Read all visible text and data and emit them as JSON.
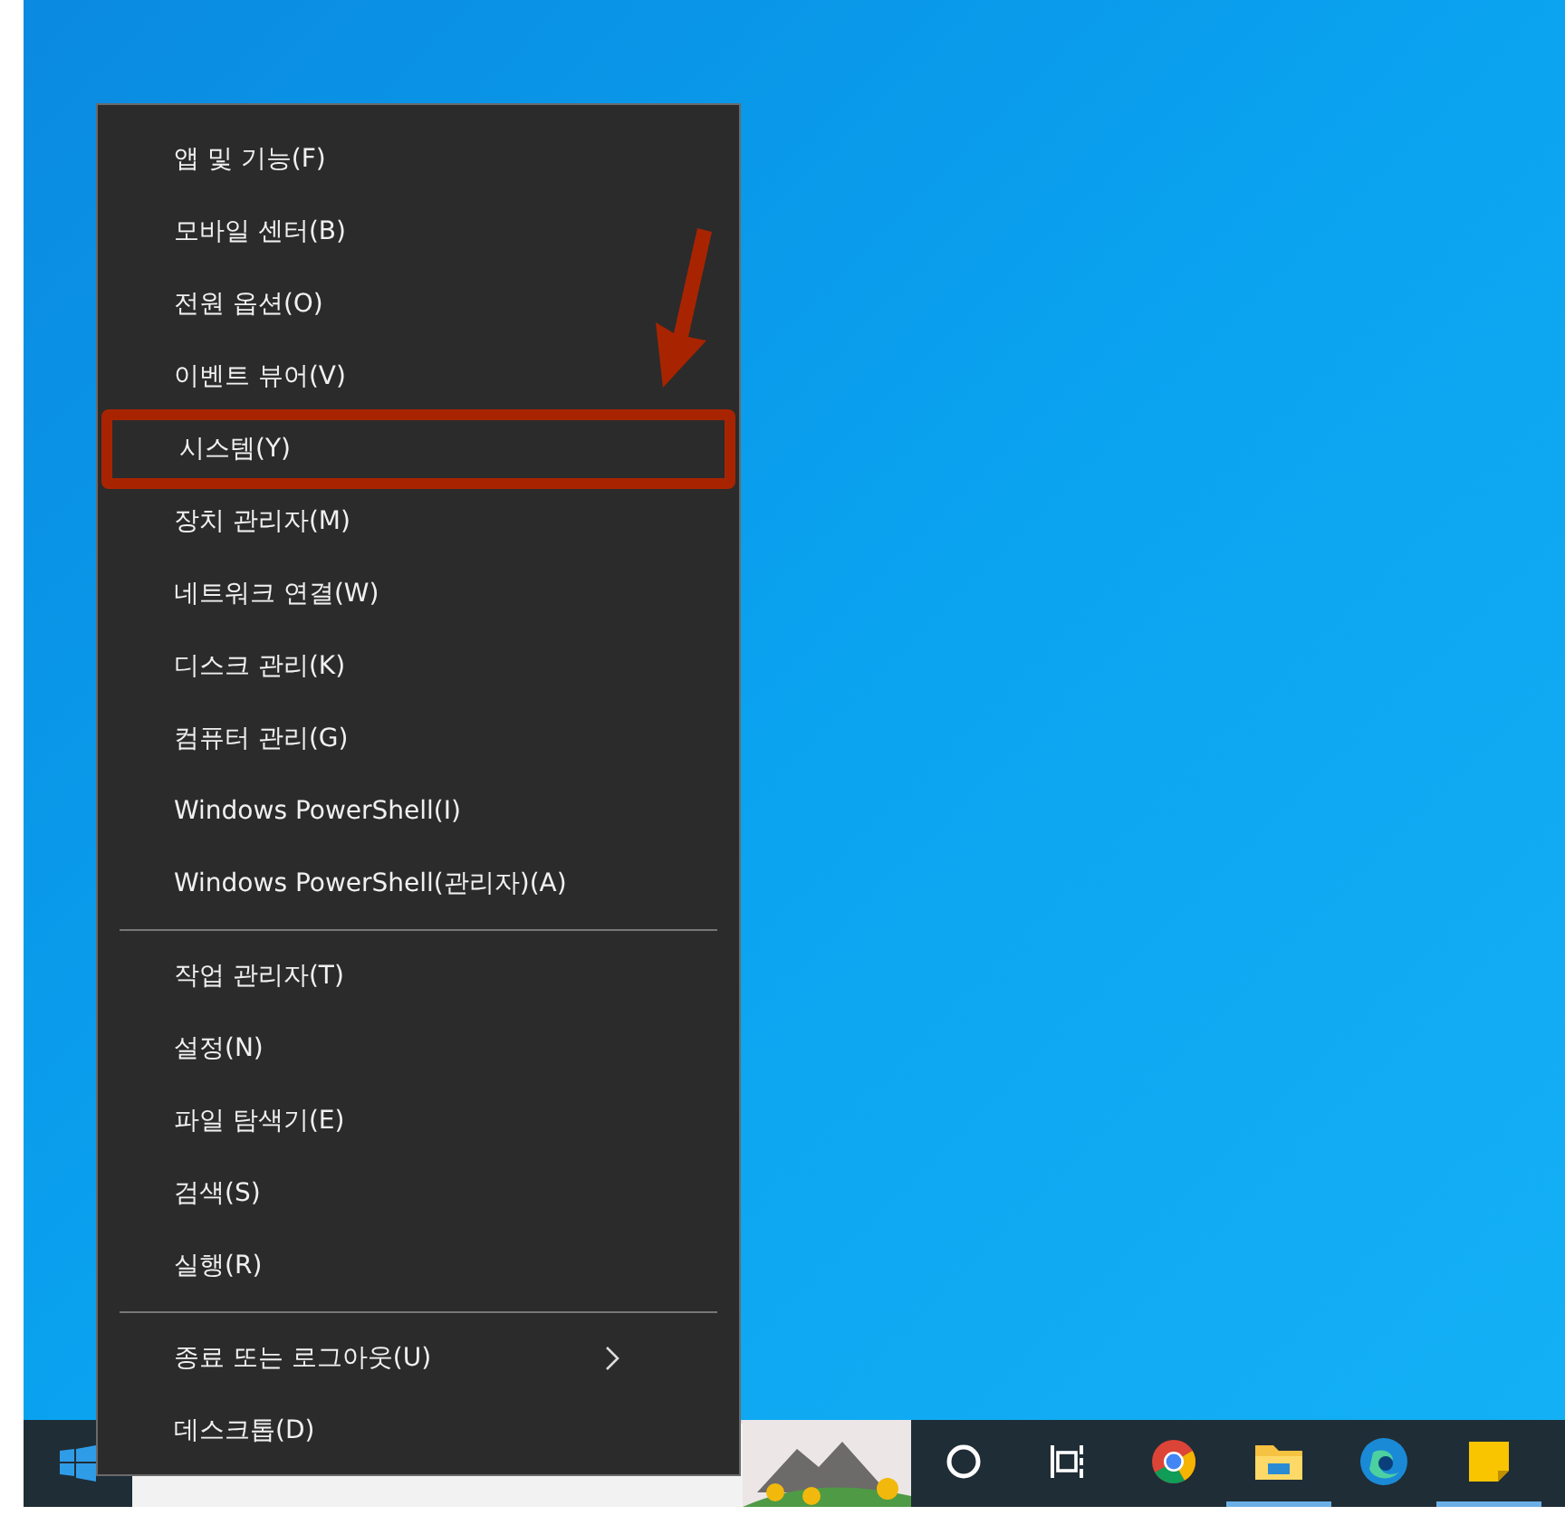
{
  "context_menu": {
    "groups": [
      {
        "items": [
          {
            "label": "앱 및 기능(F)",
            "kind": "plain",
            "annotated": false
          },
          {
            "label": "모바일 센터(B)",
            "kind": "plain",
            "annotated": false
          },
          {
            "label": "전원 옵션(O)",
            "kind": "plain",
            "annotated": false
          },
          {
            "label": "이벤트 뷰어(V)",
            "kind": "plain",
            "annotated": false
          },
          {
            "label": "시스템(Y)",
            "kind": "plain",
            "annotated": true
          },
          {
            "label": "장치 관리자(M)",
            "kind": "plain",
            "annotated": false
          },
          {
            "label": "네트워크 연결(W)",
            "kind": "plain",
            "annotated": false
          },
          {
            "label": "디스크 관리(K)",
            "kind": "plain",
            "annotated": false
          },
          {
            "label": "컴퓨터 관리(G)",
            "kind": "plain",
            "annotated": false
          },
          {
            "label": "Windows PowerShell(I)",
            "kind": "plain",
            "annotated": false
          },
          {
            "label": "Windows PowerShell(관리자)(A)",
            "kind": "plain",
            "annotated": false
          }
        ]
      },
      {
        "items": [
          {
            "label": "작업 관리자(T)",
            "kind": "plain",
            "annotated": false
          },
          {
            "label": "설정(N)",
            "kind": "plain",
            "annotated": false
          },
          {
            "label": "파일 탐색기(E)",
            "kind": "plain",
            "annotated": false
          },
          {
            "label": "검색(S)",
            "kind": "plain",
            "annotated": false
          },
          {
            "label": "실행(R)",
            "kind": "plain",
            "annotated": false
          }
        ]
      },
      {
        "items": [
          {
            "label": "종료 또는 로그아웃(U)",
            "kind": "submenu",
            "annotated": false
          },
          {
            "label": "데스크톱(D)",
            "kind": "plain",
            "annotated": false
          }
        ]
      }
    ]
  },
  "taskbar": {
    "apps": [
      {
        "kind": "cortana",
        "running": false
      },
      {
        "kind": "taskview",
        "running": false
      },
      {
        "kind": "browser",
        "running": false
      },
      {
        "kind": "folder",
        "running": true
      },
      {
        "kind": "edge",
        "running": false
      },
      {
        "kind": "notes",
        "running": true
      }
    ]
  }
}
